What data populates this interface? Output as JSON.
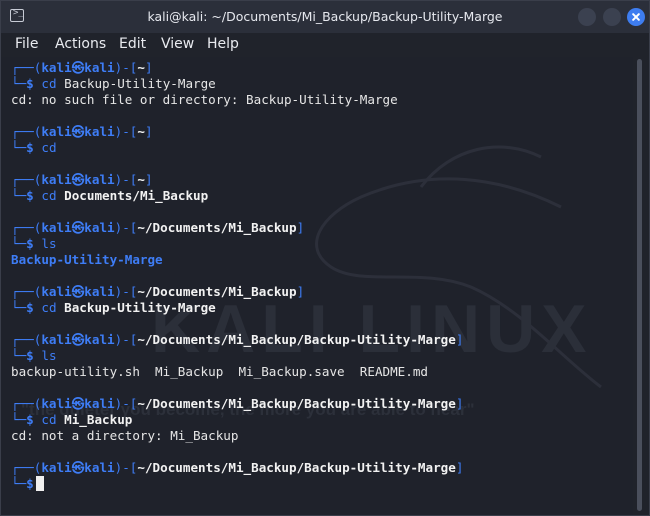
{
  "window": {
    "title": "kali@kali: ~/Documents/Mi_Backup/Backup-Utility-Marge"
  },
  "menu": [
    "File",
    "Actions",
    "Edit",
    "View",
    "Help"
  ],
  "prompt": {
    "open": "┌──(",
    "user": "kali",
    "at": "㉿",
    "host": "kali",
    "mid": ")-[",
    "close": "]",
    "end": "└─",
    "dollar": "$"
  },
  "terminal": {
    "blocks": [
      {
        "path": "~",
        "cmd": "cd",
        "arg": "Backup-Utility-Marge",
        "arg_bold": false
      },
      {
        "path": "~",
        "cmd": "cd",
        "arg": "",
        "arg_bold": false
      },
      {
        "path": "~",
        "cmd": "cd",
        "arg": "Documents/Mi_Backup",
        "arg_bold": true
      },
      {
        "path": "~/Documents/Mi_Backup",
        "cmd": "ls",
        "arg": "",
        "arg_bold": false
      },
      {
        "path": "~/Documents/Mi_Backup",
        "cmd": "cd",
        "arg": "Backup-Utility-Marge",
        "arg_bold": true
      },
      {
        "path": "~/Documents/Mi_Backup/Backup-Utility-Marge",
        "cmd": "ls",
        "arg": "",
        "arg_bold": false
      },
      {
        "path": "~/Documents/Mi_Backup/Backup-Utility-Marge",
        "cmd": "cd",
        "arg": "Mi_Backup",
        "arg_bold": true
      },
      {
        "path": "~/Documents/Mi_Backup/Backup-Utility-Marge",
        "cmd": "",
        "arg": "",
        "arg_bold": false
      }
    ],
    "outputs": {
      "out1": "cd: no such file or directory: Backup-Utility-Marge",
      "out4": "Backup-Utility-Marge",
      "out6": "backup-utility.sh  Mi_Backup  Mi_Backup.save  README.md",
      "out7": "cd: not a directory: Mi_Backup"
    }
  },
  "watermark": {
    "text": "KALI LINUX",
    "slogan": "\"the quieter you become, the more you are able to hear\""
  },
  "colors": {
    "prompt_blue": "#3e7df6",
    "background": "#1f222b",
    "titlebar": "#2b2f3a",
    "close_button": "#3e7df0"
  },
  "icons": {
    "app": "terminal-icon",
    "minimize": "minimize-icon",
    "maximize": "maximize-icon",
    "close": "close-icon"
  }
}
